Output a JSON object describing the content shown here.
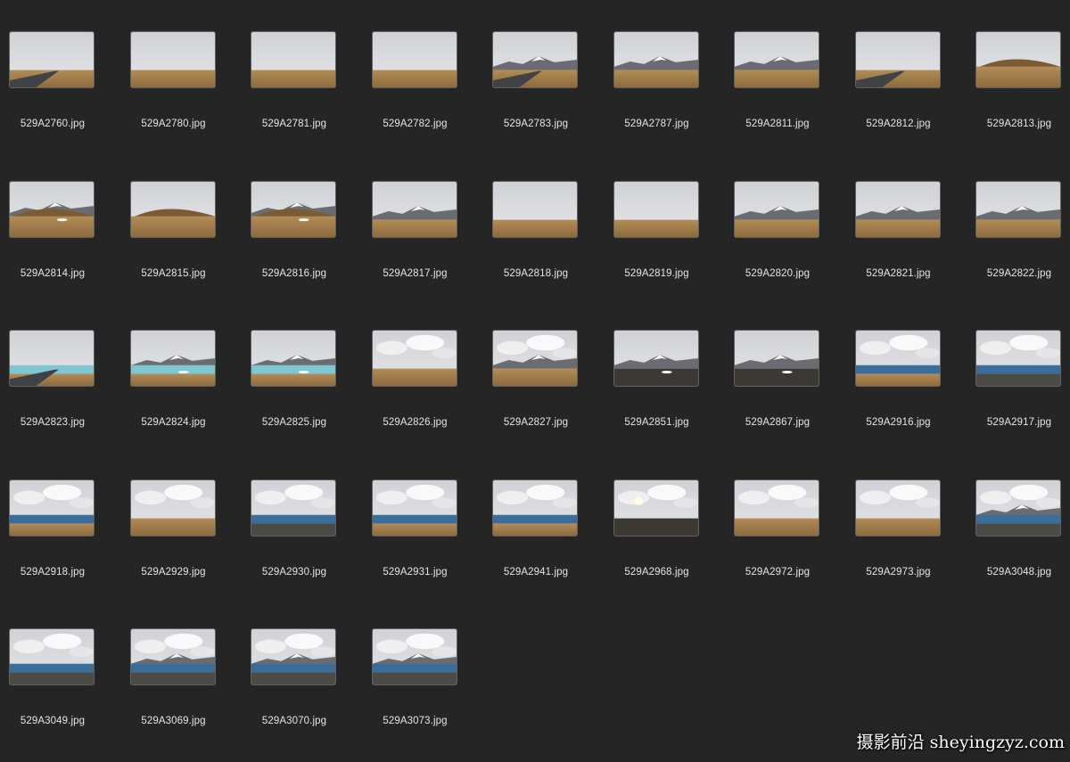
{
  "files": [
    {
      "name": "529A2760.jpg",
      "scene": "road-plain"
    },
    {
      "name": "529A2780.jpg",
      "scene": "plain"
    },
    {
      "name": "529A2781.jpg",
      "scene": "plain"
    },
    {
      "name": "529A2782.jpg",
      "scene": "plain"
    },
    {
      "name": "529A2783.jpg",
      "scene": "road-mountain"
    },
    {
      "name": "529A2787.jpg",
      "scene": "mountain-plain"
    },
    {
      "name": "529A2811.jpg",
      "scene": "mountain-plain"
    },
    {
      "name": "529A2812.jpg",
      "scene": "road-plain"
    },
    {
      "name": "529A2813.jpg",
      "scene": "hill"
    },
    {
      "name": "529A2814.jpg",
      "scene": "hill-snow"
    },
    {
      "name": "529A2815.jpg",
      "scene": "hill"
    },
    {
      "name": "529A2816.jpg",
      "scene": "hill-snow"
    },
    {
      "name": "529A2817.jpg",
      "scene": "mountain-plain"
    },
    {
      "name": "529A2818.jpg",
      "scene": "plain"
    },
    {
      "name": "529A2819.jpg",
      "scene": "overcast"
    },
    {
      "name": "529A2820.jpg",
      "scene": "snow-peak"
    },
    {
      "name": "529A2821.jpg",
      "scene": "mountain-plain"
    },
    {
      "name": "529A2822.jpg",
      "scene": "mountain-plain"
    },
    {
      "name": "529A2823.jpg",
      "scene": "lake-road"
    },
    {
      "name": "529A2824.jpg",
      "scene": "lake-snow"
    },
    {
      "name": "529A2825.jpg",
      "scene": "lake-snow"
    },
    {
      "name": "529A2826.jpg",
      "scene": "cloud-plain"
    },
    {
      "name": "529A2827.jpg",
      "scene": "cloud-mountain"
    },
    {
      "name": "529A2851.jpg",
      "scene": "dark-snow"
    },
    {
      "name": "529A2867.jpg",
      "scene": "dark-snow"
    },
    {
      "name": "529A2916.jpg",
      "scene": "cloud-lake"
    },
    {
      "name": "529A2917.jpg",
      "scene": "blue-lake"
    },
    {
      "name": "529A2918.jpg",
      "scene": "cloud-lake"
    },
    {
      "name": "529A2929.jpg",
      "scene": "big-cloud"
    },
    {
      "name": "529A2930.jpg",
      "scene": "blue-lake"
    },
    {
      "name": "529A2931.jpg",
      "scene": "cloud-lake"
    },
    {
      "name": "529A2941.jpg",
      "scene": "cloud-lake"
    },
    {
      "name": "529A2968.jpg",
      "scene": "sun-dark"
    },
    {
      "name": "529A2972.jpg",
      "scene": "cloud-plain-blue"
    },
    {
      "name": "529A2973.jpg",
      "scene": "cloud-plain-blue"
    },
    {
      "name": "529A3048.jpg",
      "scene": "blue-lake-mountain"
    },
    {
      "name": "529A3049.jpg",
      "scene": "blue-lake"
    },
    {
      "name": "529A3069.jpg",
      "scene": "blue-lake-mountain"
    },
    {
      "name": "529A3070.jpg",
      "scene": "blue-lake-mountain"
    },
    {
      "name": "529A3073.jpg",
      "scene": "blue-lake-mountain"
    }
  ],
  "watermark": "摄影前沿 sheyingzyz.com",
  "colors": {
    "background": "#252525",
    "filename_text": "#e4e4e4"
  }
}
